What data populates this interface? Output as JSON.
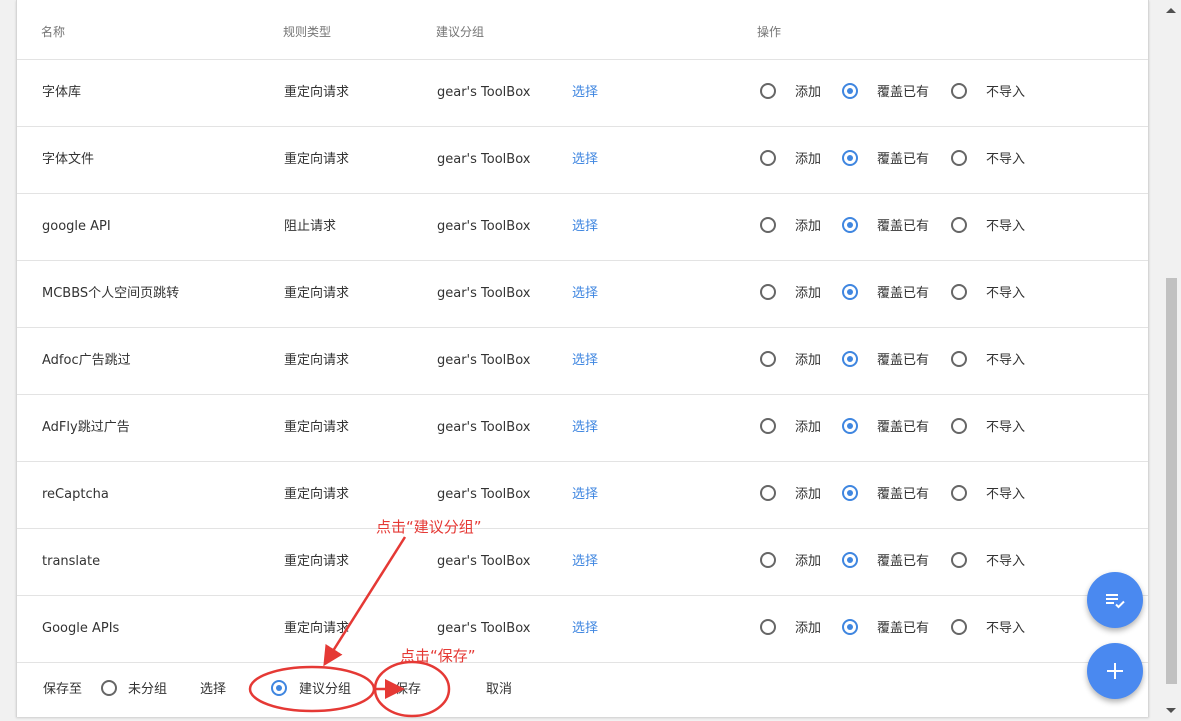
{
  "header": {
    "col_name": "名称",
    "col_type": "规则类型",
    "col_group": "建议分组",
    "col_action": "操作"
  },
  "rows": [
    {
      "name": "字体库",
      "type": "重定向请求",
      "group": "gear's ToolBox",
      "select": "选择",
      "add": "添加",
      "overwrite": "覆盖已有",
      "skip": "不导入",
      "selected": "overwrite"
    },
    {
      "name": "字体文件",
      "type": "重定向请求",
      "group": "gear's ToolBox",
      "select": "选择",
      "add": "添加",
      "overwrite": "覆盖已有",
      "skip": "不导入",
      "selected": "overwrite"
    },
    {
      "name": "google API",
      "type": "阻止请求",
      "group": "gear's ToolBox",
      "select": "选择",
      "add": "添加",
      "overwrite": "覆盖已有",
      "skip": "不导入",
      "selected": "overwrite"
    },
    {
      "name": "MCBBS个人空间页跳转",
      "type": "重定向请求",
      "group": "gear's ToolBox",
      "select": "选择",
      "add": "添加",
      "overwrite": "覆盖已有",
      "skip": "不导入",
      "selected": "overwrite"
    },
    {
      "name": "Adfoc广告跳过",
      "type": "重定向请求",
      "group": "gear's ToolBox",
      "select": "选择",
      "add": "添加",
      "overwrite": "覆盖已有",
      "skip": "不导入",
      "selected": "overwrite"
    },
    {
      "name": "AdFly跳过广告",
      "type": "重定向请求",
      "group": "gear's ToolBox",
      "select": "选择",
      "add": "添加",
      "overwrite": "覆盖已有",
      "skip": "不导入",
      "selected": "overwrite"
    },
    {
      "name": "reCaptcha",
      "type": "重定向请求",
      "group": "gear's ToolBox",
      "select": "选择",
      "add": "添加",
      "overwrite": "覆盖已有",
      "skip": "不导入",
      "selected": "overwrite"
    },
    {
      "name": "translate",
      "type": "重定向请求",
      "group": "gear's ToolBox",
      "select": "选择",
      "add": "添加",
      "overwrite": "覆盖已有",
      "skip": "不导入",
      "selected": "overwrite"
    },
    {
      "name": "Google APIs",
      "type": "重定向请求",
      "group": "gear's ToolBox",
      "select": "选择",
      "add": "添加",
      "overwrite": "覆盖已有",
      "skip": "不导入",
      "selected": "overwrite"
    }
  ],
  "footer": {
    "save_to": "保存至",
    "ungrouped": "未分组",
    "select": "选择",
    "suggested_group": "建议分组",
    "save": "保存",
    "cancel": "取消",
    "selected_option": "suggested"
  },
  "fabs": {
    "list_icon": "playlist-check-icon",
    "add_icon": "plus-icon"
  },
  "annotations": {
    "click_group": "点击“建议分组”",
    "click_save": "点击“保存”"
  },
  "colors": {
    "accent": "#3f86e0",
    "fab": "#4a89f0",
    "annotation": "#e53935"
  }
}
